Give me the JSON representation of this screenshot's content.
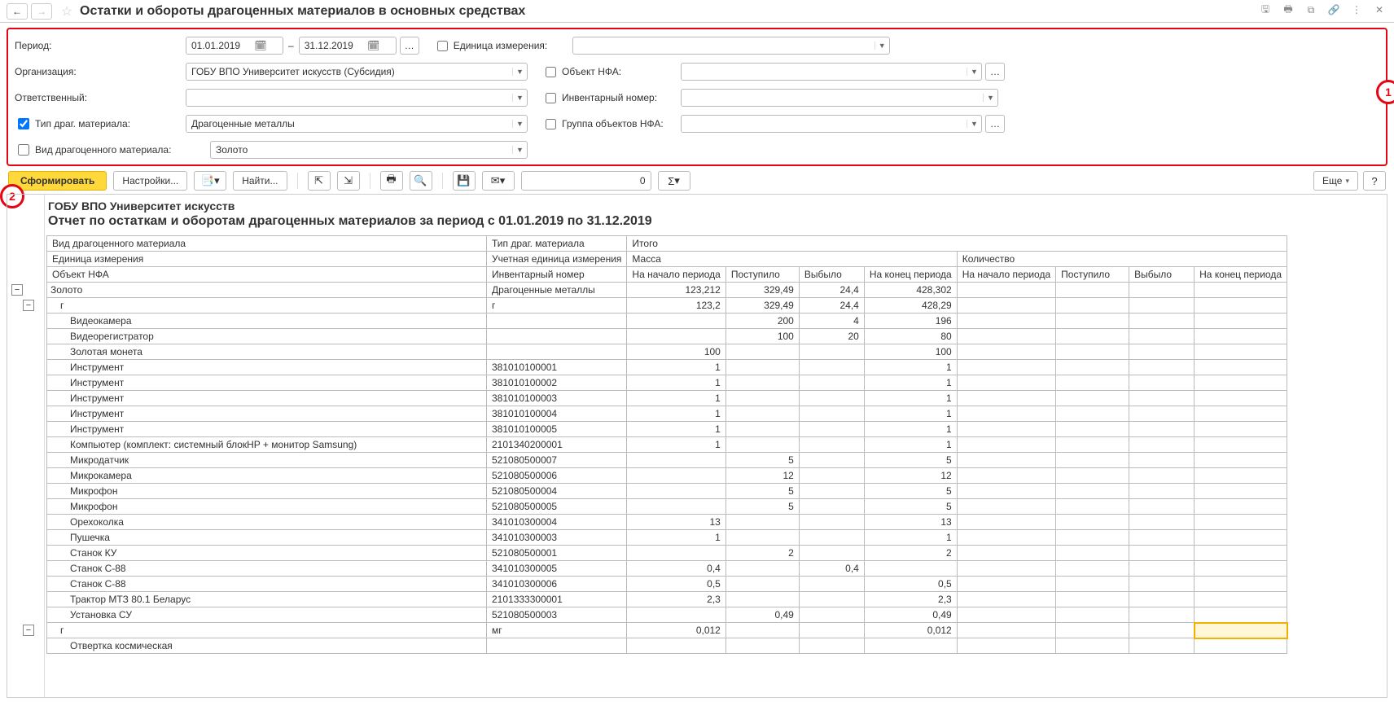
{
  "header": {
    "title": "Остатки и обороты драгоценных материалов в основных средствах"
  },
  "filters": {
    "period_label": "Период:",
    "period_from": "01.01.2019",
    "period_to": "31.12.2019",
    "dash": "–",
    "org_label": "Организация:",
    "org_value": "ГОБУ ВПО Университет искусств (Субсидия)",
    "resp_label": "Ответственный:",
    "resp_value": "",
    "type_label": "Тип драг. материала:",
    "type_value": "Драгоценные металлы",
    "kind_label": "Вид драгоценного материала:",
    "kind_value": "Золото",
    "unit_label": "Единица измерения:",
    "nfa_label": "Объект НФА:",
    "inv_label": "Инвентарный номер:",
    "group_label": "Группа объектов НФА:"
  },
  "callouts": {
    "c1": "1",
    "c2": "2"
  },
  "toolbar": {
    "form": "Сформировать",
    "settings": "Настройки...",
    "find": "Найти...",
    "sum": "0",
    "more": "Еще",
    "help": "?",
    "sigma": "Σ"
  },
  "report": {
    "org": "ГОБУ ВПО Университет искусств",
    "title": "Отчет по остаткам и оборотам драгоценных материалов за период с 01.01.2019 по 31.12.2019",
    "headers": {
      "h1a": "Вид драгоценного материала",
      "h1b": "Тип драг. материала",
      "h1c": "Итого",
      "h2a": "Единица измерения",
      "h2b": "Учетная единица измерения",
      "h2c": "Масса",
      "h2d": "Количество",
      "h3a": "Объект НФА",
      "h3b": "Инвентарный номер",
      "sub": {
        "start": "На начало периода",
        "in": "Поступило",
        "out": "Выбыло",
        "end": "На конец периода",
        "start2": "На начало периода",
        "in2": "Поступило",
        "out2": "Выбыло",
        "end2": "На конец периода"
      }
    },
    "rows": [
      {
        "k": "g1",
        "c1": "Золото",
        "c2": "Драгоценные металлы",
        "m": [
          "123,212",
          "329,49",
          "24,4",
          "428,302"
        ],
        "q": [
          "",
          "",
          "",
          ""
        ]
      },
      {
        "k": "g2",
        "c1": "г",
        "c2": "г",
        "m": [
          "123,2",
          "329,49",
          "24,4",
          "428,29"
        ],
        "q": [
          "",
          "",
          "",
          ""
        ]
      },
      {
        "c1": "Видеокамера",
        "c2": "",
        "m": [
          "",
          "200",
          "4",
          "196"
        ],
        "q": [
          "",
          "",
          "",
          ""
        ]
      },
      {
        "c1": "Видеорегистратор",
        "c2": "",
        "m": [
          "",
          "100",
          "20",
          "80"
        ],
        "q": [
          "",
          "",
          "",
          ""
        ]
      },
      {
        "c1": "Золотая монета",
        "c2": "",
        "m": [
          "100",
          "",
          "",
          "100"
        ],
        "q": [
          "",
          "",
          "",
          ""
        ]
      },
      {
        "c1": "Инструмент",
        "c2": "381010100001",
        "m": [
          "1",
          "",
          "",
          "1"
        ],
        "q": [
          "",
          "",
          "",
          ""
        ]
      },
      {
        "c1": "Инструмент",
        "c2": "381010100002",
        "m": [
          "1",
          "",
          "",
          "1"
        ],
        "q": [
          "",
          "",
          "",
          ""
        ]
      },
      {
        "c1": "Инструмент",
        "c2": "381010100003",
        "m": [
          "1",
          "",
          "",
          "1"
        ],
        "q": [
          "",
          "",
          "",
          ""
        ]
      },
      {
        "c1": "Инструмент",
        "c2": "381010100004",
        "m": [
          "1",
          "",
          "",
          "1"
        ],
        "q": [
          "",
          "",
          "",
          ""
        ]
      },
      {
        "c1": "Инструмент",
        "c2": "381010100005",
        "m": [
          "1",
          "",
          "",
          "1"
        ],
        "q": [
          "",
          "",
          "",
          ""
        ]
      },
      {
        "c1": "Компьютер (комплект: системный блокHP + монитор Samsung)",
        "c2": "2101340200001",
        "m": [
          "1",
          "",
          "",
          "1"
        ],
        "q": [
          "",
          "",
          "",
          ""
        ]
      },
      {
        "c1": "Микродатчик",
        "c2": "521080500007",
        "m": [
          "",
          "5",
          "",
          "5"
        ],
        "q": [
          "",
          "",
          "",
          ""
        ]
      },
      {
        "c1": "Микрокамера",
        "c2": "521080500006",
        "m": [
          "",
          "12",
          "",
          "12"
        ],
        "q": [
          "",
          "",
          "",
          ""
        ]
      },
      {
        "c1": "Микрофон",
        "c2": "521080500004",
        "m": [
          "",
          "5",
          "",
          "5"
        ],
        "q": [
          "",
          "",
          "",
          ""
        ]
      },
      {
        "c1": "Микрофон",
        "c2": "521080500005",
        "m": [
          "",
          "5",
          "",
          "5"
        ],
        "q": [
          "",
          "",
          "",
          ""
        ]
      },
      {
        "c1": "Орехоколка",
        "c2": "341010300004",
        "m": [
          "13",
          "",
          "",
          "13"
        ],
        "q": [
          "",
          "",
          "",
          ""
        ]
      },
      {
        "c1": "Пушечка",
        "c2": "341010300003",
        "m": [
          "1",
          "",
          "",
          "1"
        ],
        "q": [
          "",
          "",
          "",
          ""
        ]
      },
      {
        "c1": "Станок КУ",
        "c2": "521080500001",
        "m": [
          "",
          "2",
          "",
          "2"
        ],
        "q": [
          "",
          "",
          "",
          ""
        ]
      },
      {
        "c1": "Станок С-88",
        "c2": "341010300005",
        "m": [
          "0,4",
          "",
          "0,4",
          ""
        ],
        "q": [
          "",
          "",
          "",
          ""
        ]
      },
      {
        "c1": "Станок С-88",
        "c2": "341010300006",
        "m": [
          "0,5",
          "",
          "",
          "0,5"
        ],
        "q": [
          "",
          "",
          "",
          ""
        ]
      },
      {
        "c1": "Трактор МТЗ 80.1 Беларус",
        "c2": "2101333300001",
        "m": [
          "2,3",
          "",
          "",
          "2,3"
        ],
        "q": [
          "",
          "",
          "",
          ""
        ]
      },
      {
        "c1": "Установка СУ",
        "c2": "521080500003",
        "m": [
          "",
          "0,49",
          "",
          "0,49"
        ],
        "q": [
          "",
          "",
          "",
          ""
        ]
      },
      {
        "k": "g3",
        "c1": "г",
        "c2": "мг",
        "m": [
          "0,012",
          "",
          "",
          "0,012"
        ],
        "q": [
          "",
          "",
          "",
          ""
        ],
        "hl": true
      },
      {
        "c1": "Отвертка космическая",
        "c2": "",
        "m": [
          "",
          "",
          "",
          ""
        ],
        "q": [
          "",
          "",
          "",
          ""
        ]
      }
    ]
  }
}
